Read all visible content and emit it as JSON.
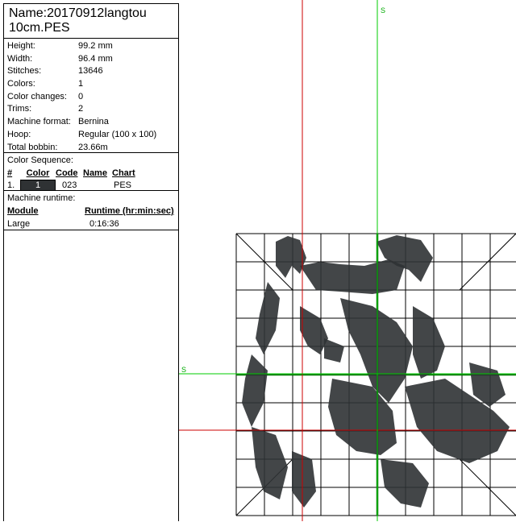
{
  "file": {
    "name_line1": "Name:20170912langtou",
    "name_line2": "10cm.PES"
  },
  "stats": [
    {
      "label": "Height:",
      "value": "99.2 mm"
    },
    {
      "label": "Width:",
      "value": "96.4 mm"
    },
    {
      "label": "Stitches:",
      "value": "13646"
    },
    {
      "label": "Colors:",
      "value": "1"
    },
    {
      "label": "Color changes:",
      "value": "0"
    },
    {
      "label": "Trims:",
      "value": "2"
    },
    {
      "label": "Machine format:",
      "value": "Bernina"
    },
    {
      "label": "Hoop:",
      "value": "Regular (100 x 100)"
    },
    {
      "label": "Total bobbin:",
      "value": "23.66m"
    }
  ],
  "color_sequence": {
    "title": "Color Sequence:",
    "headers": {
      "num": "#",
      "color": "Color",
      "code": "Code",
      "name": "Name",
      "chart": "Chart"
    },
    "rows": [
      {
        "num": "1.",
        "color": "1",
        "code": "023",
        "name": "",
        "chart": "PES",
        "swatch": "#2f3234"
      }
    ]
  },
  "runtime": {
    "title": "Machine runtime:",
    "headers": {
      "module": "Module",
      "runtime": "Runtime (hr:min:sec)"
    },
    "rows": [
      {
        "module": "Large",
        "time": "0:16:36"
      }
    ]
  },
  "canvas": {
    "axis_marker_top": "S",
    "axis_marker_left": "S",
    "colors": {
      "guide_red": "#cc0000",
      "guide_green": "#00cc00",
      "center_green": "#007700",
      "stitch": "#2f3234",
      "grid": "#000000"
    }
  }
}
